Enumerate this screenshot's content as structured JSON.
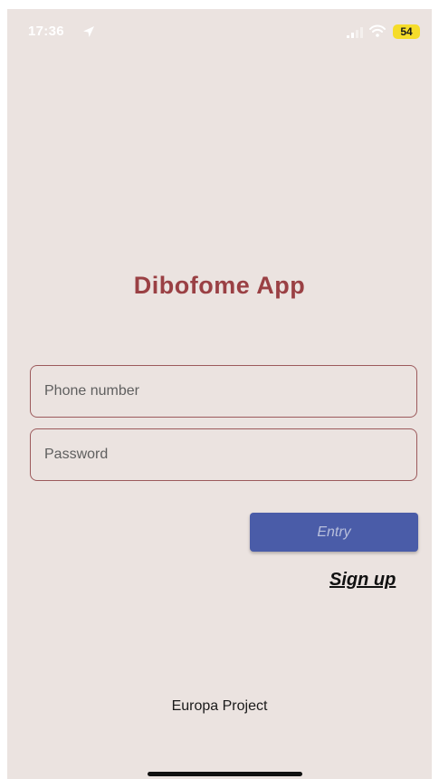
{
  "status_bar": {
    "time": "17:36",
    "location_icon": "location-arrow-icon",
    "signal_icon": "cellular-signal-icon",
    "wifi_icon": "wifi-icon",
    "battery_level": "54",
    "battery_color": "#f5dc2a"
  },
  "app": {
    "title": "Dibofome App"
  },
  "form": {
    "phone_placeholder": "Phone number",
    "phone_value": "",
    "password_placeholder": "Password",
    "password_value": "",
    "entry_label": "Entry",
    "signup_label": "Sign up"
  },
  "footer": {
    "text": "Europa Project"
  },
  "colors": {
    "background": "#ebe3e0",
    "title": "#9a4044",
    "field_border": "#9c5a5c",
    "button": "#4a5ca8"
  }
}
